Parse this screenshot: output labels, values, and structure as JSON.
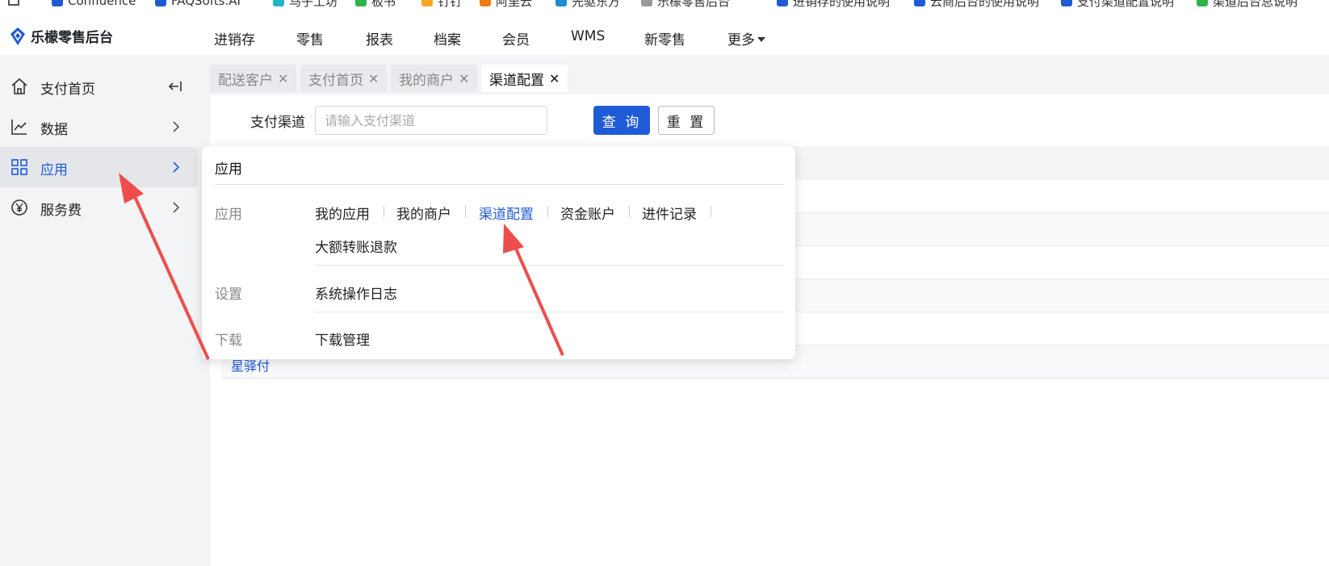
{
  "bookmarks": {
    "items": [
      {
        "label": "Confluence",
        "color": "#1f5bd6"
      },
      {
        "label": "FAQSofts.AI",
        "color": "#1f5bd6"
      },
      {
        "label": "马子工坊",
        "color": "#1fb5c8"
      },
      {
        "label": "板书",
        "color": "#2db34a"
      },
      {
        "label": "钉钉",
        "color": "#f5a623"
      },
      {
        "label": "阿里云",
        "color": "#f07c1a"
      },
      {
        "label": "先驱东方",
        "color": "#1f8ad6"
      },
      {
        "label": "乐檬零售后台",
        "color": "#999999"
      },
      {
        "label": "进销存的使用说明",
        "color": "#1f5bd6"
      },
      {
        "label": "云商后台的使用说明",
        "color": "#1f5bd6"
      },
      {
        "label": "支付渠道配置说明",
        "color": "#1f5bd6"
      },
      {
        "label": "渠道后台总说明",
        "color": "#2db34a"
      }
    ]
  },
  "header": {
    "logo_text": "乐檬零售后台",
    "brand_color": "#1f5bd6",
    "nav": [
      "进销存",
      "零售",
      "报表",
      "档案",
      "会员",
      "WMS",
      "新零售",
      "更多"
    ]
  },
  "sidebar": {
    "items": [
      {
        "label": "支付首页",
        "icon": "home-icon"
      },
      {
        "label": "数据",
        "icon": "chart-line-icon"
      },
      {
        "label": "应用",
        "icon": "grid-icon",
        "active": true
      },
      {
        "label": "服务费",
        "icon": "yen-icon"
      }
    ],
    "collapse_icon": "collapse-left-icon"
  },
  "tabs": [
    {
      "label": "配送客户"
    },
    {
      "label": "支付首页"
    },
    {
      "label": "我的商户"
    },
    {
      "label": "渠道配置",
      "active": true
    }
  ],
  "filter": {
    "label": "支付渠道",
    "placeholder": "请输入支付渠道",
    "search_label": "查 询",
    "reset_label": "重 置"
  },
  "table": {
    "visible_cell": "星驿付"
  },
  "flyout": {
    "title": "应用",
    "sections": [
      {
        "label": "应用",
        "items": [
          "我的应用",
          "我的商户",
          "渠道配置",
          "资金账户",
          "进件记录",
          "大额转账退款"
        ],
        "active": "渠道配置"
      },
      {
        "label": "设置",
        "items": [
          "系统操作日志"
        ]
      },
      {
        "label": "下载",
        "items": [
          "下载管理"
        ]
      }
    ]
  },
  "colors": {
    "accent": "#1f5bd6",
    "annotation_arrow": "#ef4d4d"
  }
}
